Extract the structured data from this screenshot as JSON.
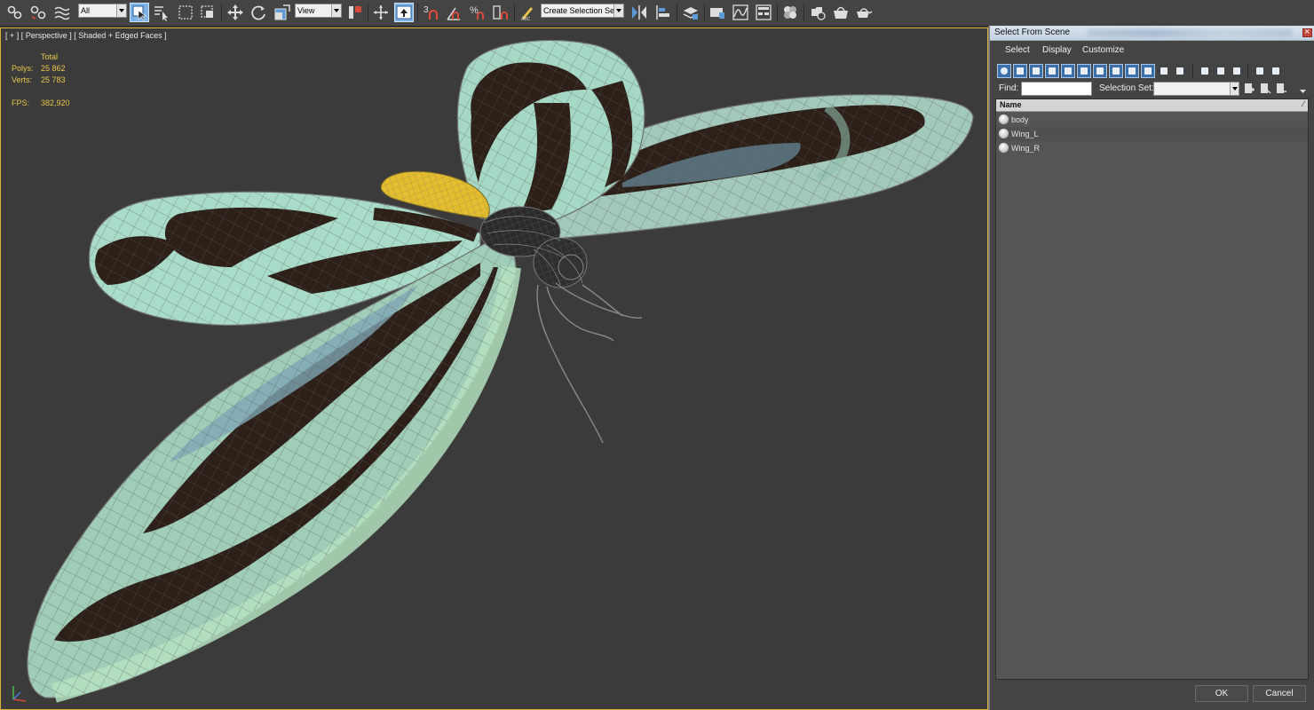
{
  "toolbar": {
    "selection_filter": "All",
    "reference_coord": "View",
    "named_selection": "Create Selection Se"
  },
  "viewport": {
    "label": "[ + ] [ Perspective ] [ Shaded + Edged Faces ]",
    "stats": {
      "total_label": "Total",
      "polys_label": "Polys:",
      "polys_value": "25 862",
      "verts_label": "Verts:",
      "verts_value": "25 783",
      "fps_label": "FPS:",
      "fps_value": "382,920"
    }
  },
  "dialog": {
    "title": "Select From Scene",
    "menus": [
      "Select",
      "Display",
      "Customize"
    ],
    "find_label": "Find:",
    "find_value": "",
    "selection_set_label": "Selection Set:",
    "selection_set_value": "",
    "column_header": "Name",
    "objects": [
      "body",
      "Wing_L",
      "Wing_R"
    ],
    "ok_label": "OK",
    "cancel_label": "Cancel"
  },
  "colors": {
    "viewport_bg": "#3b3b3b",
    "active_border": "#d8b23a",
    "stat_text": "#e8c64a",
    "wing_mint": "#9fd6c2",
    "wing_dark": "#2e2017",
    "body_yellow": "#e5c12e"
  },
  "icons": [
    "link-icon",
    "unlink-icon",
    "bind-spacewarp-icon",
    "select-object-icon",
    "select-by-name-icon",
    "rect-region-icon",
    "window-crossing-icon",
    "move-icon",
    "rotate-icon",
    "scale-icon",
    "pivot-icon",
    "keyboard-shortcut-icon",
    "snap-3d-icon",
    "angle-snap-icon",
    "percent-snap-icon",
    "spinner-snap-icon",
    "edit-named-sets-icon",
    "mirror-icon",
    "align-icon",
    "layer-manager-icon",
    "ribbon-icon",
    "curve-editor-icon",
    "schematic-view-icon",
    "material-editor-icon",
    "render-setup-icon",
    "rendered-frame-icon",
    "render-icon"
  ]
}
